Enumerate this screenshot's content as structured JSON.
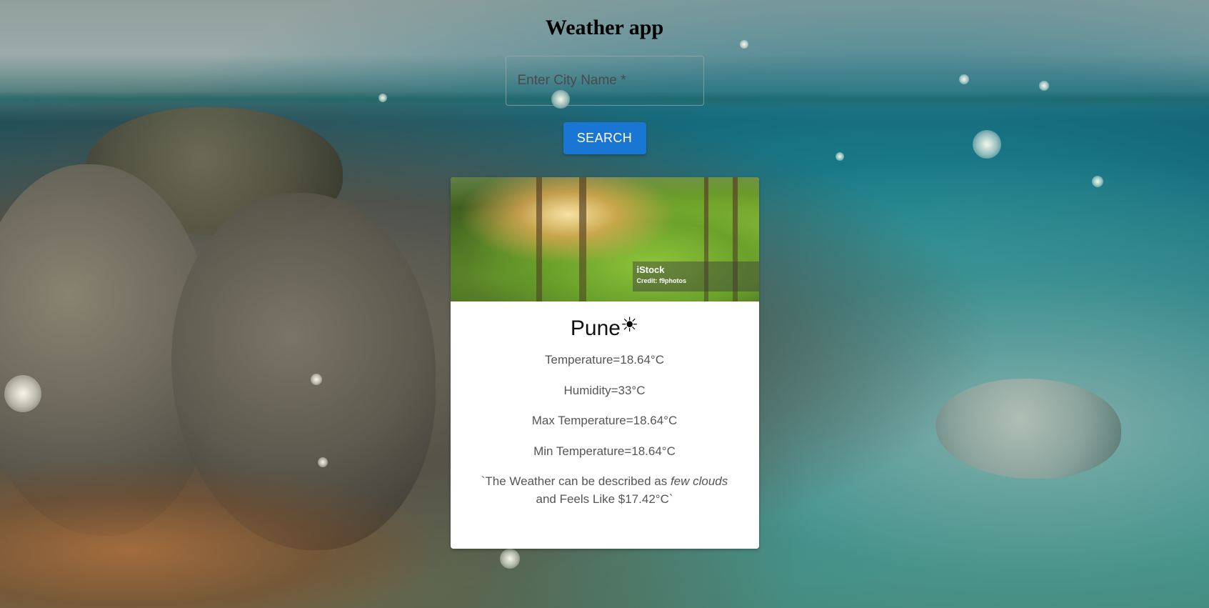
{
  "page": {
    "title": "Weather app"
  },
  "search": {
    "placeholder": "Enter City Name *",
    "value": "",
    "button_label": "SEARCH"
  },
  "card": {
    "image": {
      "credit_brand": "iStock",
      "credit_line": "Credit: f9photos"
    },
    "city": "Pune",
    "weather_icon": "sun-icon",
    "weather_glyph": "☀",
    "temperature": "Temperature=18.64°C",
    "humidity": "Humidity=33°C",
    "max_temperature": "Max Temperature=18.64°C",
    "min_temperature": "Min Temperature=18.64°C",
    "description": {
      "prefix": "`The Weather can be described as ",
      "condition": "few clouds",
      "suffix": " and Feels Like $17.42°C`"
    }
  },
  "colors": {
    "button": "#1976d2",
    "card_background": "#ffffff"
  }
}
